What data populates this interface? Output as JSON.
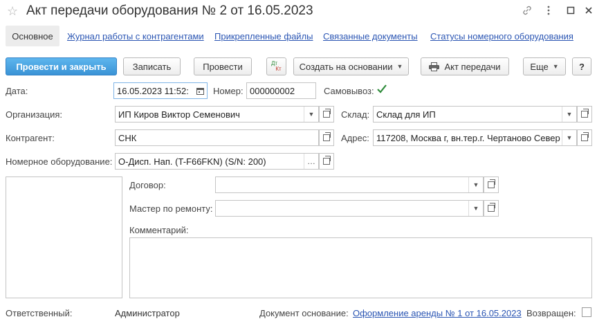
{
  "window": {
    "title": "Акт передачи оборудования № 2 от 16.05.2023",
    "icons": [
      "star-icon",
      "link-icon",
      "more-icon",
      "maximize-icon",
      "close-icon"
    ]
  },
  "tabs": [
    {
      "label": "Основное",
      "active": true
    },
    {
      "label": "Журнал работы с контрагентами"
    },
    {
      "label": "Прикрепленные файлы"
    },
    {
      "label": "Связанные документы"
    },
    {
      "label": "Статусы номерного оборудования"
    }
  ],
  "toolbar": {
    "post_close": "Провести и закрыть",
    "write": "Записать",
    "post": "Провести",
    "dt_kt_top": "Дт",
    "dt_kt_bottom": "Кт",
    "create_based": "Создать на основании",
    "print_act": "Акт передачи",
    "more": "Еще",
    "help": "?"
  },
  "form": {
    "date_label": "Дата:",
    "date_value": "16.05.2023 11:52:",
    "number_label": "Номер:",
    "number_value": "000000002",
    "pickup_label": "Самовывоз:",
    "pickup_checked": true,
    "org_label": "Организация:",
    "org_value": "ИП Киров Виктор Семенович",
    "warehouse_label": "Склад:",
    "warehouse_value": "Склад для ИП",
    "counterparty_label": "Контрагент:",
    "counterparty_value": "СНК",
    "address_label": "Адрес:",
    "address_value": "117208, Москва г, вн.тер.г. Чертаново Север",
    "equipment_label": "Номерное оборудование:",
    "equipment_value": "О-Дисп. Нап.  (T-F66FKN) (S/N: 200)",
    "contract_label": "Договор:",
    "contract_value": "",
    "master_label": "Мастер по ремонту:",
    "master_value": "",
    "comment_label": "Комментарий:",
    "comment_value": ""
  },
  "footer": {
    "responsible_label": "Ответственный:",
    "responsible_value": "Администратор",
    "basis_label": "Документ основание:",
    "basis_value": "Оформление аренды № 1 от 16.05.2023",
    "returned_label": "Возвращен:",
    "returned_checked": false
  },
  "colors": {
    "primary_button": "#3a93d6",
    "link": "#2a55b3",
    "checkmark": "#2e8b3a",
    "focus_border": "#7fb4e6"
  }
}
